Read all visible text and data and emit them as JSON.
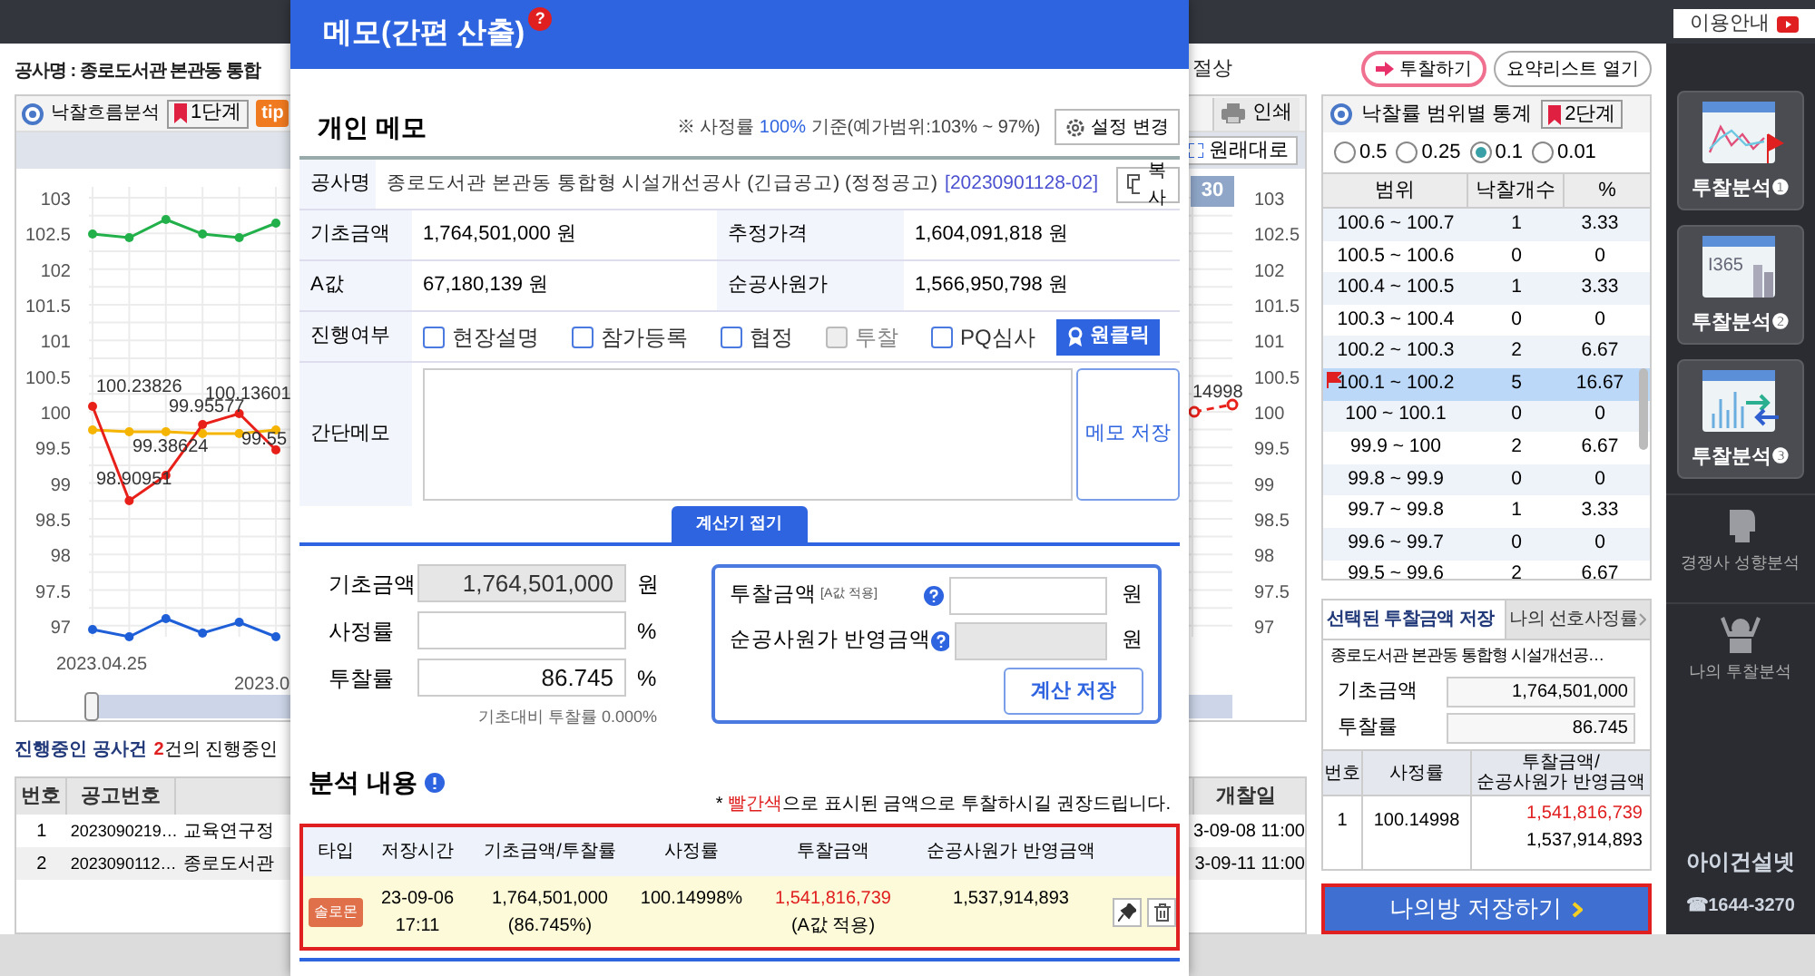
{
  "top_bar": {
    "help_button": "이용안내"
  },
  "header": {
    "project_title": "공사명 : 종로도서관 본관동 통합",
    "fragment": "절상",
    "bid_button": "투찰하기",
    "summary_button": "요약리스트 열기"
  },
  "flow_panel": {
    "title": "낙찰흐름분석",
    "step": "1단계",
    "tip": "tip",
    "print": "인쇄",
    "reset": "원래대로",
    "period": "30",
    "date_labels": [
      "2023.04.25",
      "2023.0"
    ],
    "left_axis_labels": [
      "103",
      "102.5",
      "102",
      "101.5",
      "101",
      "100.5",
      "100",
      "99.5",
      "99",
      "98.5",
      "98",
      "97.5",
      "97"
    ],
    "right_axis_labels": [
      "103",
      "102.5",
      "102",
      "101.5",
      "101",
      "100.5",
      "100",
      "99.5",
      "99",
      "98.5",
      "98",
      "97.5",
      "97"
    ],
    "data_labels": [
      "100.23826",
      "100.13601",
      "99.95577",
      "99.55",
      "99.38624",
      "98.90951",
      "14998"
    ]
  },
  "in_progress": {
    "heading": "진행중인 공사건",
    "count": "2",
    "text": "건의 진행중인",
    "columns": [
      "번호",
      "공고번호",
      "개찰일"
    ],
    "rows": [
      {
        "no": "1",
        "notice": "2023090219…",
        "name": "교육연구정",
        "date": "3-09-08 11:00"
      },
      {
        "no": "2",
        "notice": "2023090112…",
        "name": "종로도서관",
        "date": "3-09-11 11:00"
      }
    ]
  },
  "stats_panel": {
    "title": "낙찰률 범위별 통계",
    "step": "2단계",
    "intervals": [
      {
        "label": "0.5",
        "selected": false
      },
      {
        "label": "0.25",
        "selected": false
      },
      {
        "label": "0.1",
        "selected": true
      },
      {
        "label": "0.01",
        "selected": false
      }
    ],
    "columns": [
      "범위",
      "낙찰개수",
      "%"
    ],
    "rows": [
      {
        "range": "100.6 ~ 100.7",
        "count": "1",
        "pct": "3.33",
        "selected": false
      },
      {
        "range": "100.5 ~ 100.6",
        "count": "0",
        "pct": "0",
        "selected": false
      },
      {
        "range": "100.4 ~ 100.5",
        "count": "1",
        "pct": "3.33",
        "selected": false
      },
      {
        "range": "100.3 ~ 100.4",
        "count": "0",
        "pct": "0",
        "selected": false
      },
      {
        "range": "100.2 ~ 100.3",
        "count": "2",
        "pct": "6.67",
        "selected": false
      },
      {
        "range": "100.1 ~ 100.2",
        "count": "5",
        "pct": "16.67",
        "selected": true
      },
      {
        "range": "100 ~ 100.1",
        "count": "0",
        "pct": "0",
        "selected": false
      },
      {
        "range": "99.9 ~ 100",
        "count": "2",
        "pct": "6.67",
        "selected": false
      },
      {
        "range": "99.8 ~ 99.9",
        "count": "0",
        "pct": "0",
        "selected": false
      },
      {
        "range": "99.7 ~ 99.8",
        "count": "1",
        "pct": "3.33",
        "selected": false
      },
      {
        "range": "99.6 ~ 99.7",
        "count": "0",
        "pct": "0",
        "selected": false
      },
      {
        "range": "99.5 ~ 99.6",
        "count": "2",
        "pct": "6.67",
        "selected": false
      }
    ]
  },
  "saved_panel": {
    "tabs": [
      {
        "label": "선택된 투찰금액 저장",
        "selected": true
      },
      {
        "label": "나의 선호사정률",
        "selected": false
      }
    ],
    "project": "종로도서관 본관동 통합형 시설개선공…",
    "fields": [
      {
        "label": "기초금액",
        "value": "1,764,501,000"
      },
      {
        "label": "투찰률",
        "value": "86.745"
      }
    ],
    "columns": [
      "번호",
      "사정률",
      "투찰금액/\n순공사원가 반영금액"
    ],
    "rows": [
      {
        "no": "1",
        "rate": "100.14998",
        "bid": "1,541,816,739",
        "net": "1,537,914,893"
      }
    ],
    "save_button": "나의방 저장하기"
  },
  "sidebar": {
    "tiles": [
      {
        "label": "투찰분석❶",
        "kind": "flow"
      },
      {
        "label": "투찰분석❷",
        "kind": "stats",
        "icon_text": "I365"
      },
      {
        "label": "투찰분석❸",
        "kind": "arrows"
      }
    ],
    "links": [
      {
        "label": "경쟁사 성향분석",
        "kind": "head"
      },
      {
        "label": "나의 투찰분석",
        "kind": "person"
      }
    ],
    "brand": "아이건설넷",
    "phone": "☎1644-3270"
  },
  "memo_modal": {
    "title": "메모(간편 산출)",
    "help_badge": "?",
    "section": "개인 메모",
    "basis": {
      "prefix": "※ 사정률 ",
      "value": "100%",
      "suffix": " 기준(예가범위:103% ~ 97%)"
    },
    "settings_button": "설정 변경",
    "project_label": "공사명",
    "project_name": "종로도서관 본관동 통합형 시설개선공사 (긴급공고) (정정공고)",
    "notice_link": "[20230901128-02]",
    "copy_button": "복사",
    "pairs": [
      [
        {
          "label": "기초금액",
          "value": "1,764,501,000 원"
        },
        {
          "label": "추정가격",
          "value": "1,604,091,818 원"
        }
      ],
      [
        {
          "label": "A값",
          "value": "67,180,139 원"
        },
        {
          "label": "순공사원가",
          "value": "1,566,950,798 원"
        }
      ]
    ],
    "progress_label": "진행여부",
    "progress": [
      {
        "label": "현장설명",
        "checked": false,
        "disabled": false
      },
      {
        "label": "참가등록",
        "checked": false,
        "disabled": false
      },
      {
        "label": "협정",
        "checked": false,
        "disabled": false
      },
      {
        "label": "투찰",
        "checked": false,
        "disabled": true
      },
      {
        "label": "PQ심사",
        "checked": false,
        "disabled": false
      }
    ],
    "one_click": "원클릭",
    "memo_label": "간단메모",
    "memo_save": "메모 저장",
    "calc_toggle": "계산기 접기",
    "calc_fields": [
      {
        "label": "기초금액",
        "value": "1,764,501,000",
        "unit": "원",
        "disabled": true
      },
      {
        "label": "사정률",
        "unit": "%",
        "disabled": false
      },
      {
        "label": "투찰률",
        "value": "86.745",
        "unit": "%",
        "disabled": false
      }
    ],
    "ratio_note": "기초대비 투찰률 0.000%",
    "results": [
      {
        "label": "투찰금액",
        "sub": "[A값 적용]",
        "unit": "원",
        "disabled": false
      },
      {
        "label": "순공사원가 반영금액",
        "unit": "원",
        "disabled": true
      }
    ],
    "calc_save": "계산 저장",
    "analysis_title": "분석 내용",
    "note": {
      "prefix": "* ",
      "highlight": "빨간색",
      "rest": "으로 표시된 금액으로 투찰하시길 권장드립니다."
    },
    "columns": [
      "타입",
      "저장시간",
      "기초금액/투찰률",
      "사정률",
      "투찰금액",
      "순공사원가 반영금액"
    ],
    "rows": [
      {
        "type": "솔로몬",
        "date": "23-09-06",
        "time": "17:11",
        "base": "1,764,501,000",
        "rate_pct": "(86.745%)",
        "rate": "100.14998%",
        "bid": "1,541,816,739",
        "bid_note": "(A값 적용)",
        "net": "1,537,914,893"
      }
    ]
  }
}
